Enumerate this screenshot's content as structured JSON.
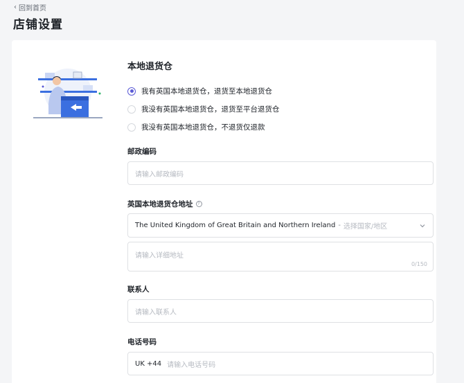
{
  "header": {
    "back_label": "回到首页",
    "title": "店铺设置"
  },
  "section": {
    "title": "本地退货仓"
  },
  "radio_options": [
    {
      "label": "我有英国本地退货仓，退货至本地退货仓",
      "checked": true
    },
    {
      "label": "我没有英国本地退货仓，退货至平台退货仓",
      "checked": false
    },
    {
      "label": "我没有英国本地退货仓，不退货仅退款",
      "checked": false
    }
  ],
  "postal": {
    "label": "邮政编码",
    "placeholder": "请输入邮政编码"
  },
  "address": {
    "label": "英国本地退货仓地址",
    "country_value": "The United Kingdom of Great Britain and Northern Ireland",
    "separator": "-",
    "region_placeholder": "选择国家/地区",
    "detail_placeholder": "请输入详细地址",
    "counter": "0/150"
  },
  "contact": {
    "label": "联系人",
    "placeholder": "请输入联系人"
  },
  "phone": {
    "label": "电话号码",
    "prefix": "UK +44",
    "placeholder": "请输入电话号码"
  },
  "colors": {
    "accent": "#5b5bd6",
    "page_bg": "#f4f5f7",
    "illustration_blue": "#3b6fe0"
  }
}
